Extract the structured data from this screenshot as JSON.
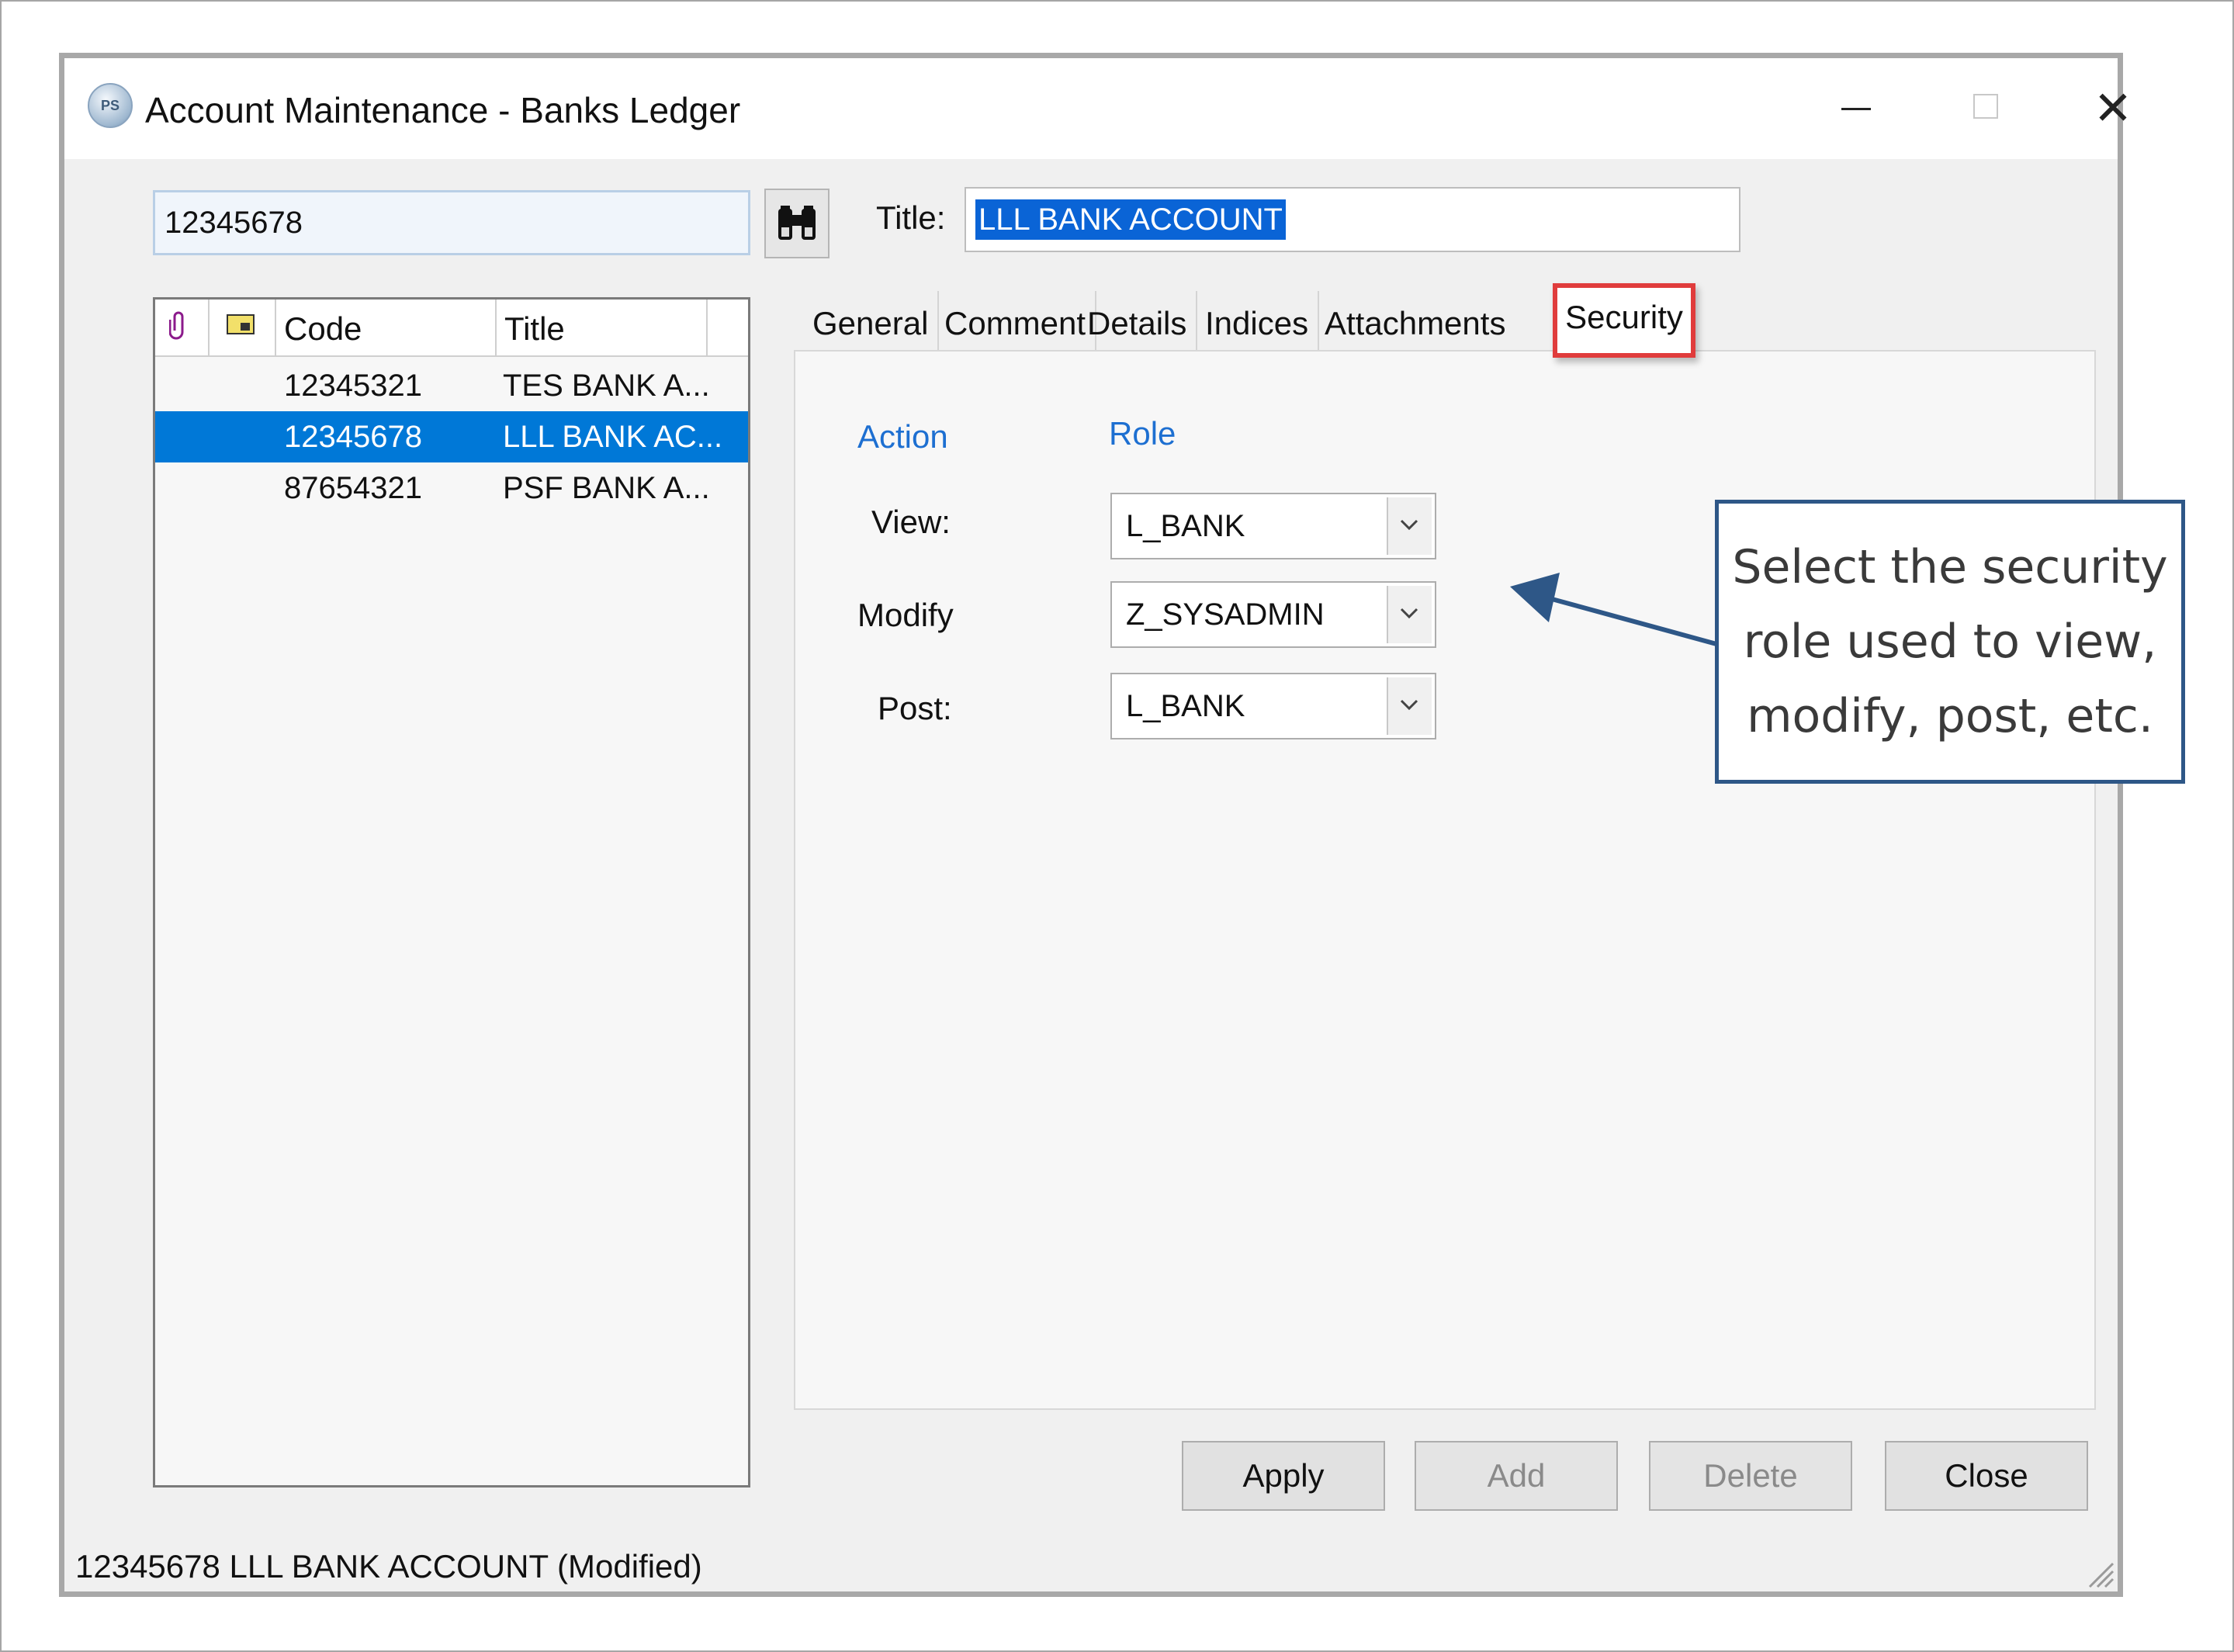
{
  "window": {
    "title": "Account Maintenance - Banks Ledger",
    "icon_text": "PS",
    "minimize_icon": "minimize-icon",
    "maximize_icon": "maximize-icon",
    "close_icon": "close-icon"
  },
  "search": {
    "value": "12345678",
    "button_icon": "binoculars-icon"
  },
  "account_list": {
    "columns": [
      "Code",
      "Title"
    ],
    "rows": [
      {
        "code": "12345321",
        "title": "TES BANK A..."
      },
      {
        "code": "12345678",
        "title": "LLL BANK AC...",
        "selected": true
      },
      {
        "code": "87654321",
        "title": "PSF BANK A..."
      }
    ]
  },
  "title_field": {
    "label": "Title:",
    "value": "LLL BANK ACCOUNT"
  },
  "tabs": [
    "General",
    "Comment",
    "Details",
    "Indices",
    "Attachments",
    "Security"
  ],
  "active_tab": "Security",
  "security": {
    "action_header": "Action",
    "role_header": "Role",
    "rows": [
      {
        "action": "View:",
        "role": "L_BANK"
      },
      {
        "action": "Modify",
        "role": "Z_SYSADMIN"
      },
      {
        "action": "Post:",
        "role": "L_BANK"
      }
    ]
  },
  "buttons": {
    "apply": "Apply",
    "add": "Add",
    "delete": "Delete",
    "close": "Close"
  },
  "status_bar": {
    "text": "12345678 LLL BANK ACCOUNT (Modified)"
  },
  "callout": {
    "lines": [
      "Select the security",
      "role used to view,",
      "modify, post, etc."
    ]
  },
  "colors": {
    "selection": "#0078d7",
    "highlight_box": "#e03c3c",
    "callout_border": "#2e5787",
    "column_header": "#1d6fd1"
  }
}
